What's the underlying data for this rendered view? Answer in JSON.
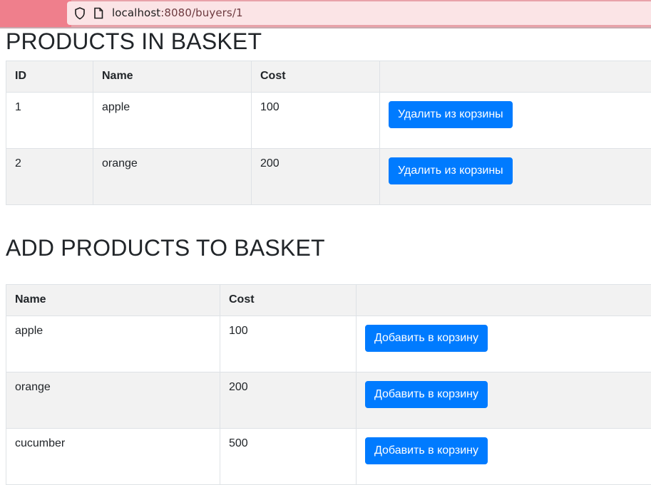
{
  "browser": {
    "url_host": "localhost",
    "url_rest": ":8080/buyers/1"
  },
  "basket": {
    "heading": "PRODUCTS IN BASKET",
    "columns": [
      "ID",
      "Name",
      "Cost",
      ""
    ],
    "rows": [
      {
        "id": "1",
        "name": "apple",
        "cost": "100",
        "action": "Удалить из корзины"
      },
      {
        "id": "2",
        "name": "orange",
        "cost": "200",
        "action": "Удалить из корзины"
      }
    ]
  },
  "add": {
    "heading": "ADD PRODUCTS TO BASKET",
    "columns": [
      "Name",
      "Cost",
      ""
    ],
    "rows": [
      {
        "name": "apple",
        "cost": "100",
        "action": "Добавить в корзину"
      },
      {
        "name": "orange",
        "cost": "200",
        "action": "Добавить в корзину"
      },
      {
        "name": "cucumber",
        "cost": "500",
        "action": "Добавить в корзину"
      }
    ]
  },
  "colors": {
    "button": "#007bff",
    "stripe": "#f2f2f2",
    "border": "#dee2e6"
  }
}
